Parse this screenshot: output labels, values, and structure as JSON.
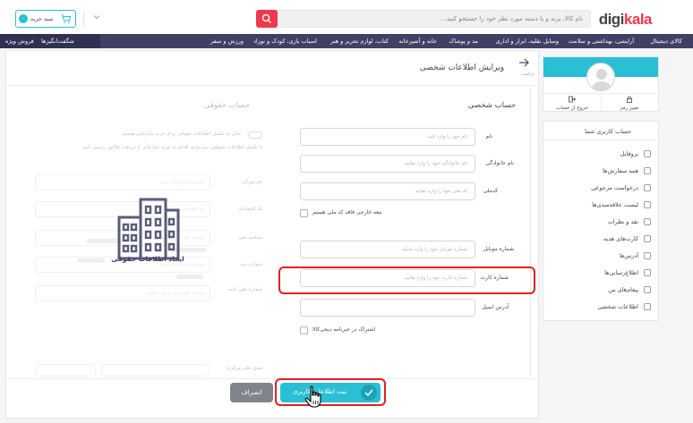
{
  "header": {
    "logo_text": "digi",
    "logo_accent": "kala",
    "search_placeholder": "نام کالا، برند و یا دسته مورد نظر خود را جستجو کنید…",
    "cart_label": "سبد خرید",
    "cart_count": "۰"
  },
  "nav": {
    "items": [
      "کالای دیجیتال",
      "آرایشی، بهداشتی و سلامت",
      "وسایل نقلیه، ابزار و اداری",
      "مد و پوشاک",
      "خانه و آشپزخانه",
      "کتاب، لوازم تحریر و هنر",
      "اسباب بازی، کودک و نوزاد",
      "ورزش و سفر"
    ],
    "left_items": [
      "فروش ویژه",
      "شگفت‌انگیزها"
    ]
  },
  "sidebar": {
    "actions": {
      "change_password": "تغییر رمز",
      "logout": "خروج از حساب"
    },
    "menu_title": "حساب کاربری شما",
    "menu_items": [
      "پروفایل",
      "همه سفارش‌ها",
      "درخواست مرجوعی",
      "لیست علاقه‌مندی‌ها",
      "نقد و نظرات",
      "کارت‌های هدیه",
      "آدرس‌ها",
      "اطلاع‌رسانی‌ها",
      "پیغام‌های من",
      "اطلاعات شخصی"
    ]
  },
  "page": {
    "title": "ویرایش اطلاعات شخصی",
    "back_sub": "بازگشت"
  },
  "personal": {
    "title": "حساب شخصی",
    "first_name": {
      "label": "نام",
      "placeholder": "نام خود را وارد کنید"
    },
    "last_name": {
      "label": "نام خانوادگی",
      "placeholder": "نام خانوادگی خود را وارد نمایید"
    },
    "national_code": {
      "label": "کدملی",
      "placeholder": "کد ملی خود را وارد نمایید"
    },
    "foreign_label": "تبعه خارجی فاقد کد ملی هستم",
    "mobile": {
      "label": "شماره موبایل",
      "placeholder": "شماره موبایل خود را وارد نمایید"
    },
    "card": {
      "label": "شماره کارت",
      "placeholder": "شماره کارت خود را وارد نمایید"
    },
    "email": {
      "label": "آدرس ایمیل",
      "placeholder": ""
    },
    "newsletter_label": "اشتراک در خبرنامه دیجی‌کالا"
  },
  "legal": {
    "title": "حساب حقوقی",
    "toggle_note": "مایل به تکمیل اطلاعات حقوقی برای خرید سازمانی هستم",
    "description": "با تکمیل اطلاعات حقوقی، می‌توانید اقدام به خرید سازمانی با دریافت فاکتور رسمی کنید",
    "fields": [
      {
        "label": "نام شرکت",
        "placeholder": "نام شرکت را وارد نمایید"
      },
      {
        "label": "کد اقتصادی",
        "placeholder": "کد اقتصادی را وارد نمایید"
      },
      {
        "label": "شناسه ملی",
        "placeholder": "شناسه ملی را وارد نمایید"
      },
      {
        "label": "شماره ثبت",
        "placeholder": "شماره ثبت را وارد نمایید"
      },
      {
        "label": "شماره تلفن ثابت",
        "placeholder": "شماره تلفن ثابت را وارد نمایید"
      }
    ],
    "location_label": "محل دفتر مرکزی",
    "create_link": "ایجاد اطلاعات حقوقی"
  },
  "buttons": {
    "submit": "ثبت اطلاعات کاربری",
    "cancel": "انصراف"
  },
  "colors": {
    "brand_red": "#ef394e",
    "accent_cyan": "#2abfd4",
    "nav_bg": "#3f4064",
    "highlight": "#e02020"
  }
}
